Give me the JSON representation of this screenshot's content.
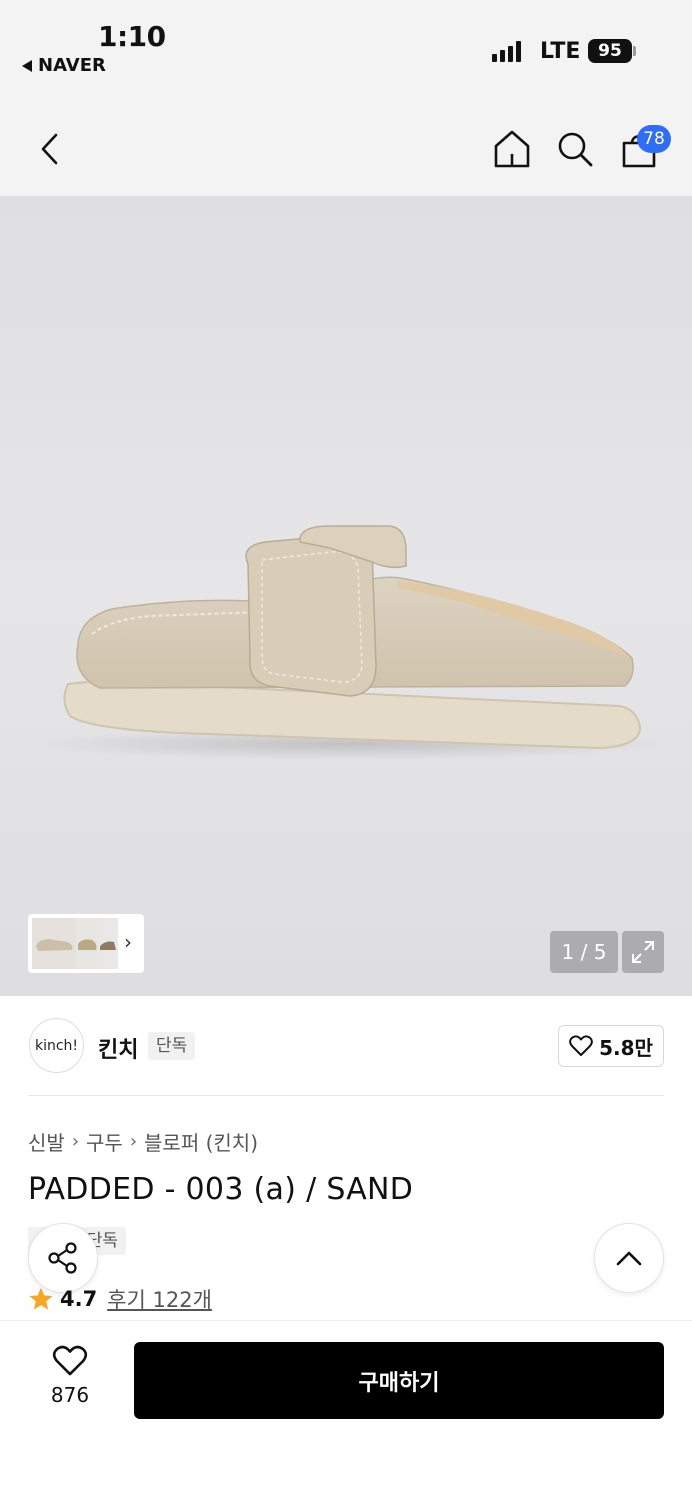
{
  "status_bar": {
    "time": "1:10",
    "back_app": "NAVER",
    "network": "LTE",
    "battery": "95"
  },
  "header": {
    "icons": [
      "back-icon",
      "home-icon",
      "search-icon",
      "cart-icon"
    ],
    "cart_count": "78"
  },
  "gallery": {
    "pager": "1 / 5"
  },
  "brand": {
    "logo_text": "kinch!",
    "name": "킨치",
    "tag": "단독",
    "likes": "5.8만"
  },
  "breadcrumb": [
    "신발",
    "구두",
    "블로퍼 (킨치)"
  ],
  "product": {
    "title": "PADDED - 003 (a) / SAND",
    "badge": "단독",
    "rating": "4.7",
    "reviews": "후기 122개"
  },
  "bottom": {
    "wish_count": "876",
    "buy_label": "구매하기"
  },
  "colors": {
    "accent": "#2f6df6",
    "star": "#f5a623",
    "buy_button": "#000000"
  }
}
